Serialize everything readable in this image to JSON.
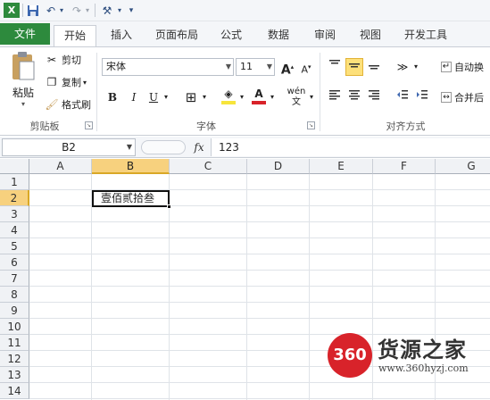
{
  "tabs": {
    "file": "文件",
    "items": [
      "开始",
      "插入",
      "页面布局",
      "公式",
      "数据",
      "审阅",
      "视图",
      "开发工具"
    ]
  },
  "clipboard": {
    "paste": "粘贴",
    "cut": "剪切",
    "copy": "复制",
    "format_painter": "格式刷",
    "label": "剪贴板"
  },
  "font": {
    "name": "宋体",
    "size": "11",
    "grow": "A",
    "shrink": "A",
    "bold": "B",
    "italic": "I",
    "underline": "U",
    "label": "字体"
  },
  "alignment": {
    "wrap": "自动换",
    "merge": "合并后",
    "label": "对齐方式"
  },
  "formula_bar": {
    "name_box": "B2",
    "fx": "fx",
    "value": "123"
  },
  "grid": {
    "columns": [
      "A",
      "B",
      "C",
      "D",
      "E",
      "F",
      "G"
    ],
    "rows": [
      "1",
      "2",
      "3",
      "4",
      "5",
      "6",
      "7",
      "8",
      "9",
      "10",
      "11",
      "12",
      "13",
      "14"
    ],
    "active_column": "B",
    "active_row": "2",
    "cell_b2": "壹佰贰拾叁"
  },
  "watermark": {
    "badge": "360",
    "name": "货源之家",
    "url": "www.360hyzj.com"
  }
}
